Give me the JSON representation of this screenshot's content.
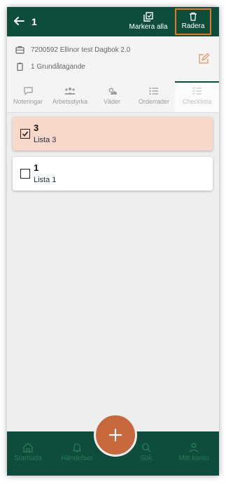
{
  "header": {
    "title": "1",
    "select_all_label": "Markera alla",
    "delete_label": "Radera"
  },
  "info": {
    "project": "7200592 Ellinor test Dagbok 2.0",
    "task": "1 Grundåtagande"
  },
  "tabs": [
    {
      "label": "Noteringar"
    },
    {
      "label": "Arbetsstyrka"
    },
    {
      "label": "Väder"
    },
    {
      "label": "Orderrader"
    },
    {
      "label": "Checklista"
    }
  ],
  "checklists": [
    {
      "number": "3",
      "label": "Lista 3",
      "checked": true
    },
    {
      "number": "1",
      "label": "Lista 1",
      "checked": false
    }
  ],
  "bottom_nav": [
    {
      "label": "Startsida"
    },
    {
      "label": "Händelser"
    },
    {
      "label": "Sök"
    },
    {
      "label": "Mitt konto"
    }
  ],
  "colors": {
    "primary": "#0e4d3b",
    "accent": "#c8693d",
    "selected_row": "#f8d9c9",
    "highlight_border": "#e07a22"
  }
}
